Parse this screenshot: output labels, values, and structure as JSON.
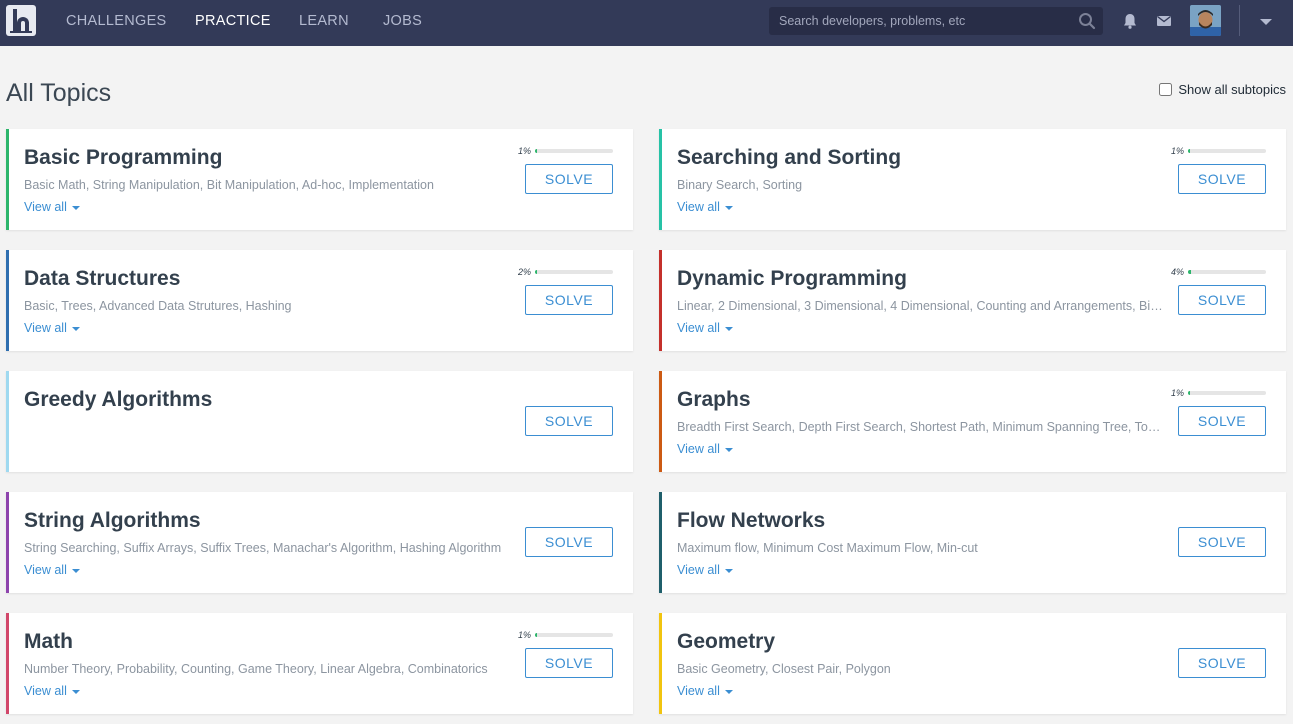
{
  "nav": {
    "links": [
      "CHALLENGES",
      "PRACTICE",
      "LEARN",
      "JOBS"
    ],
    "active_index": 1,
    "search_placeholder": "Search developers, problems, etc"
  },
  "page": {
    "title": "All Topics",
    "show_subtopics_label": "Show all subtopics"
  },
  "solve_label": "SOLVE",
  "view_all_label": "View all",
  "cards": [
    {
      "title": "Basic Programming",
      "subtopics": "Basic Math, String Manipulation, Bit Manipulation, Ad-hoc, Implementation",
      "progress": "1%",
      "progress_value": 1,
      "accent": "#2cb56b",
      "has_view_all": true
    },
    {
      "title": "Searching and Sorting",
      "subtopics": "Binary Search, Sorting",
      "progress": "1%",
      "progress_value": 1,
      "accent": "#26c2a6",
      "has_view_all": true
    },
    {
      "title": "Data Structures",
      "subtopics": "Basic, Trees, Advanced Data Strutures, Hashing",
      "progress": "2%",
      "progress_value": 2,
      "accent": "#2f6fb0",
      "has_view_all": true
    },
    {
      "title": "Dynamic Programming",
      "subtopics": "Linear, 2 Dimensional, 3 Dimensional, 4 Dimensional, Counting and Arrangements, Bit Masking",
      "progress": "4%",
      "progress_value": 4,
      "accent": "#c4302b",
      "has_view_all": true
    },
    {
      "title": "Greedy Algorithms",
      "subtopics": "",
      "progress": "",
      "progress_value": null,
      "accent": "#9fd9f0",
      "has_view_all": false
    },
    {
      "title": "Graphs",
      "subtopics": "Breadth First Search, Depth First Search, Shortest Path, Minimum Spanning Tree, Topological Sort",
      "progress": "1%",
      "progress_value": 1,
      "accent": "#cc5a13",
      "has_view_all": true
    },
    {
      "title": "String Algorithms",
      "subtopics": "String Searching, Suffix Arrays, Suffix Trees, Manachar's Algorithm, Hashing Algorithm",
      "progress": "",
      "progress_value": null,
      "accent": "#8e44ad",
      "has_view_all": true
    },
    {
      "title": "Flow Networks",
      "subtopics": "Maximum flow, Minimum Cost Maximum Flow, Min-cut",
      "progress": "",
      "progress_value": null,
      "accent": "#1f5f6b",
      "has_view_all": true
    },
    {
      "title": "Math",
      "subtopics": "Number Theory, Probability, Counting, Game Theory, Linear Algebra, Combinatorics",
      "progress": "1%",
      "progress_value": 1,
      "accent": "#d1476a",
      "has_view_all": true
    },
    {
      "title": "Geometry",
      "subtopics": "Basic Geometry, Closest Pair, Polygon",
      "progress": "",
      "progress_value": null,
      "accent": "#f1c40f",
      "has_view_all": true
    }
  ]
}
